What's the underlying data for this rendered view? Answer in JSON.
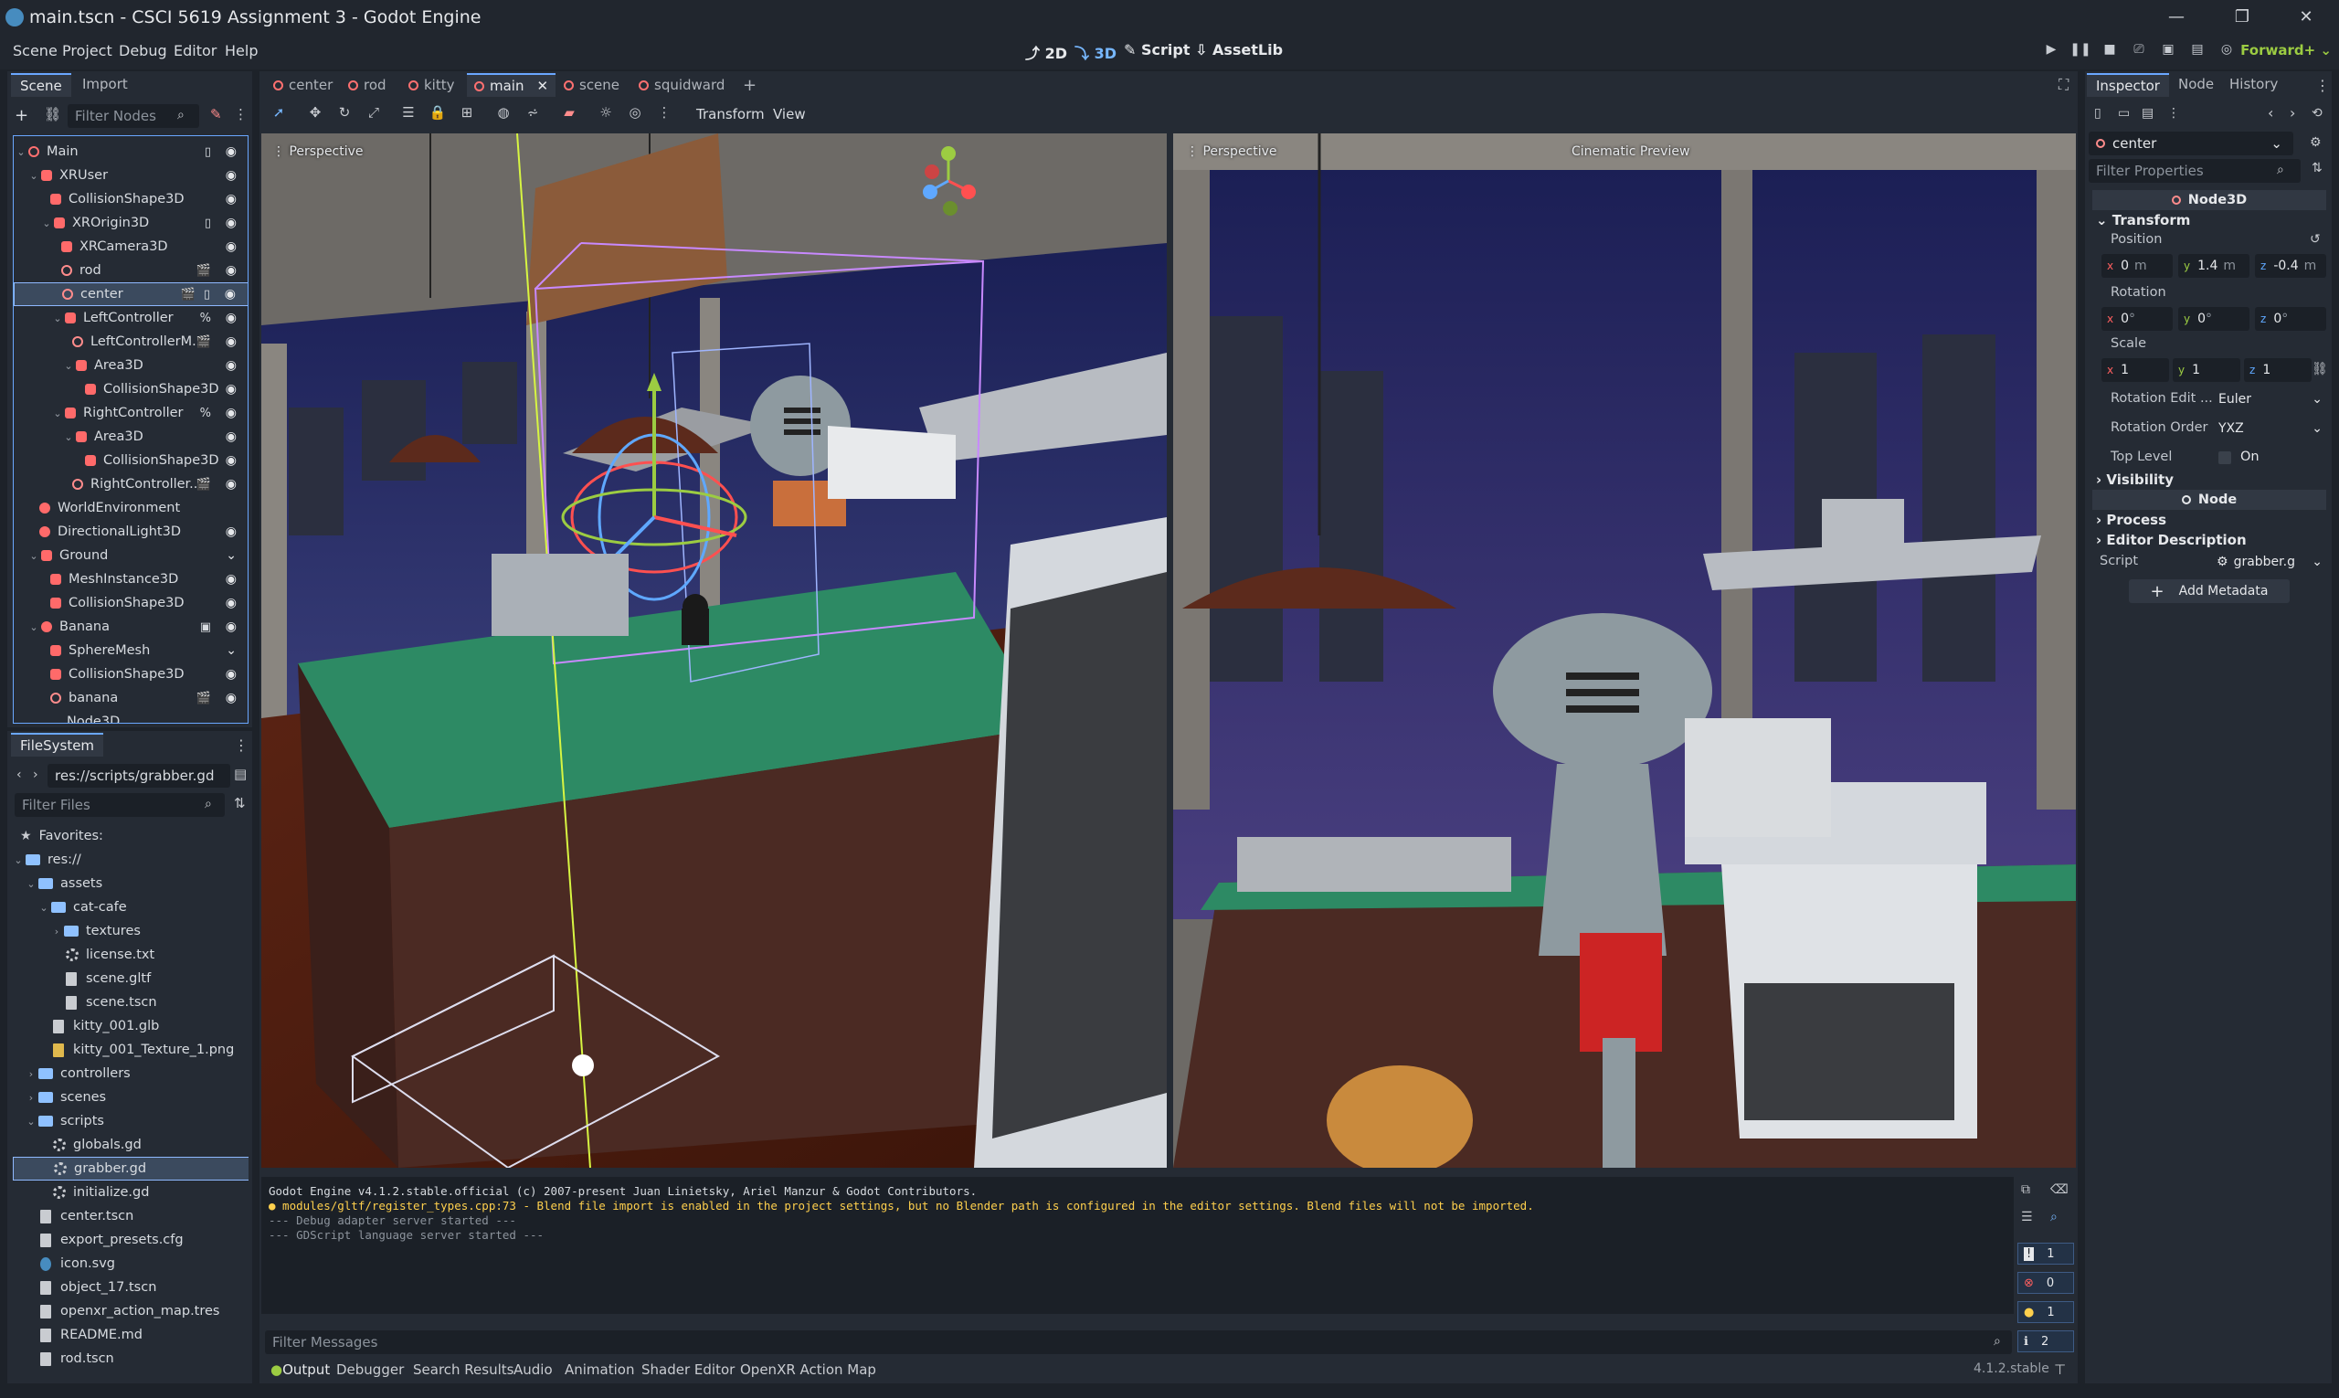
{
  "window": {
    "title": "main.tscn - CSCI 5619 Assignment 3 - Godot Engine",
    "controls": [
      "—",
      "❐",
      "✕"
    ]
  },
  "menu": {
    "items": [
      "Scene",
      "Project",
      "Debug",
      "Editor",
      "Help"
    ]
  },
  "workspaces": {
    "items": [
      "2D",
      "3D",
      "Script",
      "AssetLib"
    ],
    "active": "3D"
  },
  "renderer": "Forward+",
  "scene_dock": {
    "tabs": [
      "Scene",
      "Import"
    ],
    "filter_placeholder": "Filter Nodes",
    "nodes": [
      {
        "label": "Main"
      },
      {
        "label": "XRUser"
      },
      {
        "label": "CollisionShape3D"
      },
      {
        "label": "XROrigin3D"
      },
      {
        "label": "XRCamera3D"
      },
      {
        "label": "rod"
      },
      {
        "label": "center"
      },
      {
        "label": "LeftController"
      },
      {
        "label": "LeftControllerM..."
      },
      {
        "label": "Area3D"
      },
      {
        "label": "CollisionShape3D"
      },
      {
        "label": "RightController"
      },
      {
        "label": "Area3D"
      },
      {
        "label": "CollisionShape3D"
      },
      {
        "label": "RightController..."
      },
      {
        "label": "WorldEnvironment"
      },
      {
        "label": "DirectionalLight3D"
      },
      {
        "label": "Ground"
      },
      {
        "label": "MeshInstance3D"
      },
      {
        "label": "CollisionShape3D"
      },
      {
        "label": "Banana"
      },
      {
        "label": "SphereMesh"
      },
      {
        "label": "CollisionShape3D"
      },
      {
        "label": "banana"
      },
      {
        "label": "Node3D"
      }
    ]
  },
  "filesystem": {
    "tab": "FileSystem",
    "path": "res://scripts/grabber.gd",
    "filter_placeholder": "Filter Files",
    "items": [
      {
        "label": "Favorites:"
      },
      {
        "label": "res://"
      },
      {
        "label": "assets"
      },
      {
        "label": "cat-cafe"
      },
      {
        "label": "textures"
      },
      {
        "label": "license.txt"
      },
      {
        "label": "scene.gltf"
      },
      {
        "label": "scene.tscn"
      },
      {
        "label": "kitty_001.glb"
      },
      {
        "label": "kitty_001_Texture_1.png"
      },
      {
        "label": "controllers"
      },
      {
        "label": "scenes"
      },
      {
        "label": "scripts"
      },
      {
        "label": "globals.gd"
      },
      {
        "label": "grabber.gd"
      },
      {
        "label": "initialize.gd"
      },
      {
        "label": "center.tscn"
      },
      {
        "label": "export_presets.cfg"
      },
      {
        "label": "icon.svg"
      },
      {
        "label": "object_17.tscn"
      },
      {
        "label": "openxr_action_map.tres"
      },
      {
        "label": "README.md"
      },
      {
        "label": "rod.tscn"
      }
    ]
  },
  "scene_tabs": [
    "center",
    "rod",
    "kitty",
    "main",
    "scene",
    "squidward"
  ],
  "viewport_toolbar": {
    "transform": "Transform",
    "view": "View"
  },
  "viewports": {
    "left": {
      "label": "Perspective"
    },
    "right": {
      "label": "Perspective",
      "preview": "Cinematic Preview"
    }
  },
  "output": {
    "lines": [
      "Godot Engine v4.1.2.stable.official (c) 2007-present Juan Linietsky, Ariel Manzur & Godot Contributors.",
      "● modules/gltf/register_types.cpp:73 - Blend file import is enabled in the project settings, but no Blender path is configured in the editor settings. Blend files will not be imported.",
      "--- Debug adapter server started ---",
      "--- GDScript language server started ---"
    ],
    "filter_placeholder": "Filter Messages",
    "counts": {
      "messages": "1",
      "errors": "0",
      "warnings": "1",
      "info": "2"
    },
    "tabs": [
      "Output",
      "Debugger",
      "Search Results",
      "Audio",
      "Animation",
      "Shader Editor",
      "OpenXR Action Map"
    ],
    "version": "4.1.2.stable"
  },
  "inspector": {
    "tabs": [
      "Inspector",
      "Node",
      "History"
    ],
    "object": "center",
    "filter_placeholder": "Filter Properties",
    "class": "Node3D",
    "transform_section": "Transform",
    "position_label": "Position",
    "position": {
      "x": "0",
      "y": "1.4",
      "z": "-0.4",
      "unit": "m"
    },
    "rotation_label": "Rotation",
    "rotation": {
      "x": "0",
      "y": "0",
      "z": "0",
      "unit": "°"
    },
    "scale_label": "Scale",
    "scale": {
      "x": "1",
      "y": "1",
      "z": "1"
    },
    "rotation_edit_label": "Rotation Edit ...",
    "rotation_edit_value": "Euler",
    "rotation_order_label": "Rotation Order",
    "rotation_order_value": "YXZ",
    "top_level_label": "Top Level",
    "top_level_value": "On",
    "visibility": "Visibility",
    "node_class": "Node",
    "process": "Process",
    "editor_description": "Editor Description",
    "script_label": "Script",
    "script_value": "grabber.g",
    "add_metadata": "Add Metadata"
  }
}
